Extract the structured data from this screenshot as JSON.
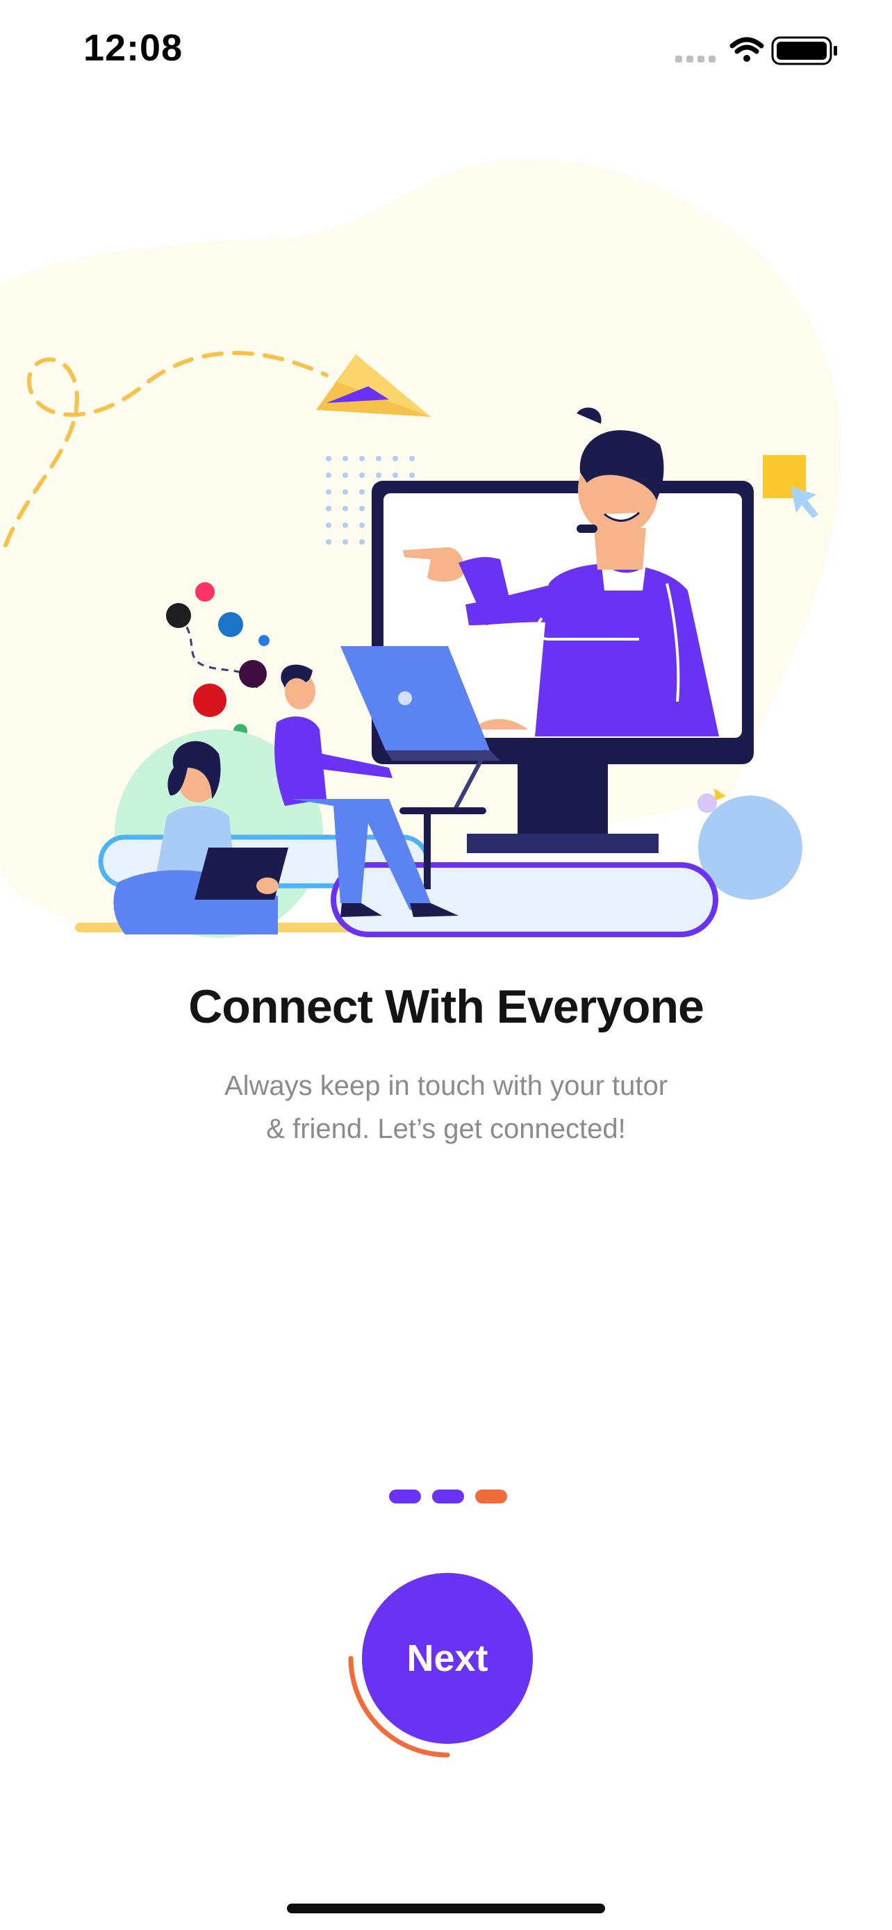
{
  "status_bar": {
    "time": "12:08",
    "icons": [
      "cellular-signal-icon",
      "wifi-icon",
      "battery-icon"
    ]
  },
  "onboarding": {
    "title": "Connect With Everyone",
    "subtitle_line1": "Always keep in touch with your tutor",
    "subtitle_line2": "& friend. Let’s get connected!",
    "page_indicator": {
      "total_pages": 3,
      "current_page": 3
    },
    "next_button_label": "Next",
    "progress_ring_fraction": 0.25
  },
  "colors": {
    "primary": "#6a33f3",
    "accent": "#f26b3a",
    "title_text": "#141414",
    "subtitle_text": "#8b8b8b",
    "illustration_blob": "#fdfcee"
  }
}
